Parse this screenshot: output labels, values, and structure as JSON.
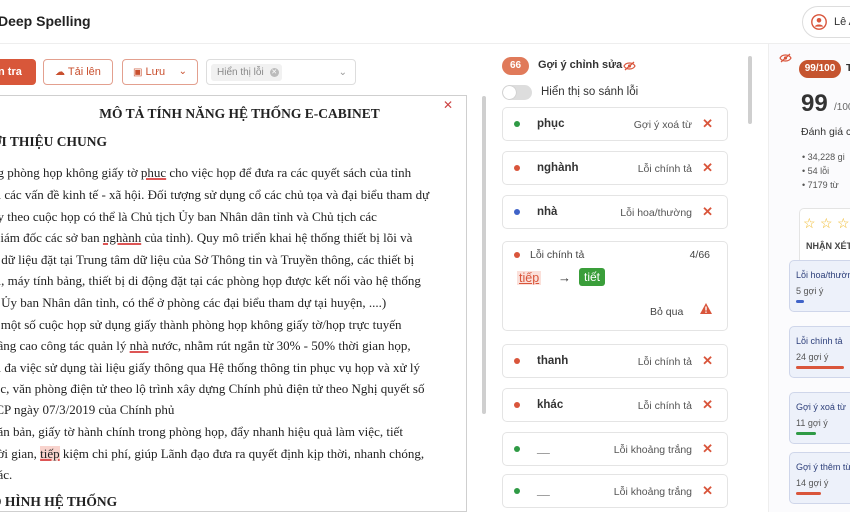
{
  "app": {
    "title": "Deep Spelling",
    "user_name": "Lê A"
  },
  "toolbar": {
    "check_label": "n tra",
    "upload_label": "Tải lên",
    "save_label": "Lưu",
    "filter_chip": "Hiển thị lỗi"
  },
  "document": {
    "title": "MÔ TẢ TÍNH NĂNG HỆ THỐNG E-CABINET",
    "heading1": "ỚI THIỆU CHUNG",
    "lines": [
      {
        "pre": "ng phòng họp không giấy tờ ",
        "err": "phuc",
        "post": " cho việc họp để đưa ra các quyết sách của tỉnh"
      },
      {
        "text": "ối các vấn đề kinh tế - xã hội. Đối tượng sử dụng cổ các chủ tọa và đại biểu tham dự"
      },
      {
        "text": "ùy theo cuộc họp có thể là Chủ tịch Ủy ban Nhân dân tỉnh và Chủ tịch các"
      },
      {
        "pre": "Giám đốc các sở ban ",
        "err": "nghành",
        "post": " của tỉnh). Quy mô triển khai hệ thống thiết bị lõi và"
      },
      {
        "text": "ữ dữ liệu đặt tại Trung tâm dữ liệu của Sở Thông tin và Truyền thông, các thiết bị"
      },
      {
        "text": "ối, máy tính bảng, thiết bị di động đặt tại các phòng họp được kết nối vào hệ thống"
      },
      {
        "text": "ở Ủy ban Nhân dân tỉnh, có thể ở phòng các đại biểu tham dự tại huyện, ....)"
      },
      {
        "text": "n một số cuộc họp sử dụng giấy thành phòng họp không giấy tờ/họp trực tuyến"
      },
      {
        "pre": "nâng cao công tác quản lý ",
        "err": "nhà",
        "post": " nước, nhằm rút ngắn từ 30% - 50% thời gian họp,"
      },
      {
        "text": "ối đa việc sử dụng tài liệu giấy thông qua Hệ thống thông tin phục vụ họp và xử lý"
      },
      {
        "text": "iệc, văn phòng điện tử theo lộ trình xây dựng Chính phủ điện tử theo Nghị quyết số"
      },
      {
        "text": "-CP ngày 07/3/2019 của Chính phủ"
      },
      {
        "text": "văn bản, giấy tờ hành chính trong phòng họp, đẩy nhanh hiệu quả làm việc, tiết"
      },
      {
        "pre": "hời gian, ",
        "hl": "tiếp",
        "post": " kiệm chi phí, giúp Lãnh đạo đưa ra quyết định kịp thời, nhanh chóng,"
      },
      {
        "text": "xác."
      }
    ],
    "heading2": "Ô HÌNH HỆ THỐNG"
  },
  "suggestions": {
    "count": "66",
    "title": "Gợi ý chỉnh sửa",
    "toggle_label": "Hiển thị so sánh lỗi",
    "items": [
      {
        "word": "phục",
        "kind": "Gợi ý xoá từ",
        "color": "#2f9a45"
      },
      {
        "word": "nghành",
        "kind": "Lỗi chính tả",
        "color": "#d9553b"
      },
      {
        "word": "nhà",
        "kind": "Lỗi hoa/thường",
        "color": "#3f63c8"
      }
    ],
    "open_item": {
      "kind": "Lỗi chính tả",
      "counter": "4/66",
      "wrong": "tiếp",
      "arrow": "→",
      "right": "tiết",
      "skip": "Bỏ qua"
    },
    "items_after": [
      {
        "word": "thanh",
        "kind": "Lỗi chính tả",
        "color": "#d9553b"
      },
      {
        "word": "khác",
        "kind": "Lỗi chính tả",
        "color": "#d9553b"
      },
      {
        "word": "__",
        "kind": "Lỗi khoảng trắng",
        "color": "#2f9a45"
      },
      {
        "word": "__",
        "kind": "Lỗi khoảng trắng",
        "color": "#2f9a45"
      }
    ],
    "close_glyph": "✕"
  },
  "stats": {
    "score_badge": "99/100",
    "badge_tail": "T",
    "score": "99",
    "score_sub": "/100",
    "score_label": "Đánh giá c",
    "lines": [
      "34,228 gi",
      "54 lỗi",
      "7179 từ"
    ],
    "review_label": "NHẬN XÉT",
    "cards": [
      {
        "title": "Lỗi hoa/thườn",
        "count": "5 gợi ý",
        "color": "#3f63c8",
        "fill": 0.15
      },
      {
        "title": "Lỗi chính tả",
        "count": "24 gợi ý",
        "color": "#d9553b",
        "fill": 0.85
      },
      {
        "title": "Gợi ý xoá từ",
        "count": "11 gợi ý",
        "color": "#2f9a45",
        "fill": 0.35
      },
      {
        "title": "Gợi ý thêm từ",
        "count": "14 gợi ý",
        "color": "#d9553b",
        "fill": 0.45
      }
    ]
  }
}
